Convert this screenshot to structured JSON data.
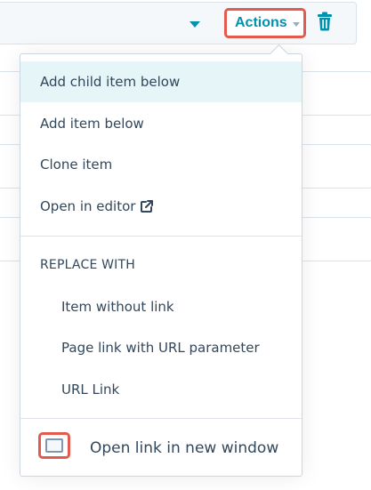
{
  "toolbar": {
    "actions_label": "Actions"
  },
  "menu": {
    "items": [
      {
        "label": "Add child item below"
      },
      {
        "label": "Add item below"
      },
      {
        "label": "Clone item"
      },
      {
        "label": "Open in editor"
      }
    ],
    "replace_section_label": "REPLACE WITH",
    "replace_items": [
      {
        "label": "Item without link"
      },
      {
        "label": "Page link with URL parameter"
      },
      {
        "label": "URL Link"
      }
    ],
    "checkbox_label": "Open link in new window",
    "checkbox_checked": false
  },
  "icons": {
    "trash": "trash-icon",
    "external_link": "external-link-icon",
    "caret": "caret-down-icon",
    "chevron": "chevron-down-icon"
  },
  "colors": {
    "accent": "#0091ae",
    "highlight": "#e5f5f8",
    "callout": "#e45a4f",
    "text": "#33475b"
  }
}
